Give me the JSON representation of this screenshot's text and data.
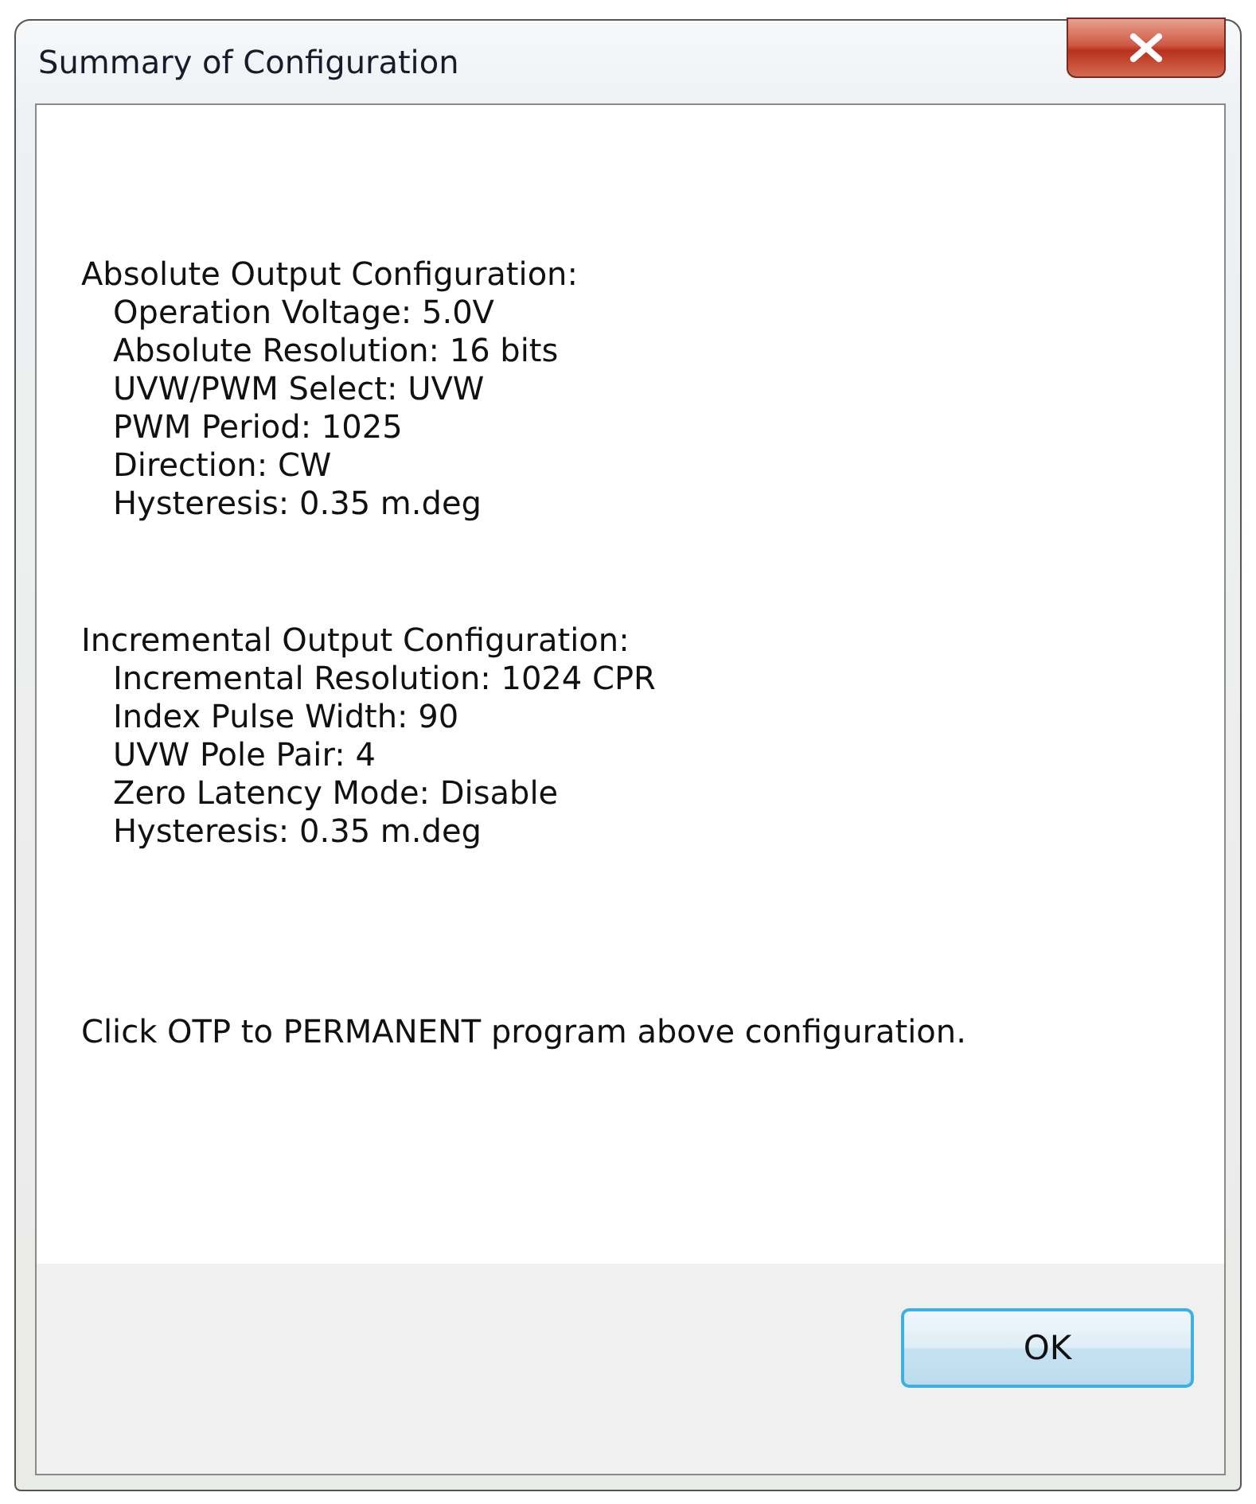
{
  "window": {
    "title": "Summary of Configuration"
  },
  "sections": [
    {
      "heading": "Absolute Output Configuration:",
      "items": [
        "Operation Voltage: 5.0V",
        "Absolute Resolution: 16 bits",
        "UVW/PWM Select: UVW",
        "PWM Period: 1025",
        "Direction: CW",
        "Hysteresis: 0.35 m.deg"
      ]
    },
    {
      "heading": "Incremental Output Configuration:",
      "items": [
        "Incremental Resolution: 1024 CPR",
        "Index Pulse Width: 90",
        "UVW Pole Pair: 4",
        "Zero Latency Mode: Disable",
        "Hysteresis: 0.35 m.deg"
      ]
    }
  ],
  "note": "Click OTP to PERMANENT program above configuration.",
  "buttons": [
    "OK"
  ]
}
